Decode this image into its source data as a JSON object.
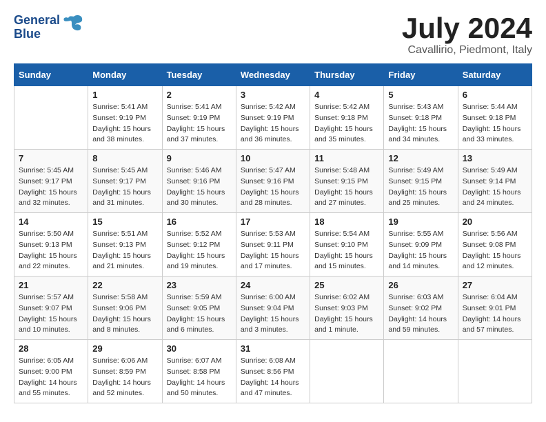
{
  "header": {
    "logo_line1": "General",
    "logo_line2": "Blue",
    "month_year": "July 2024",
    "location": "Cavallirio, Piedmont, Italy"
  },
  "days_of_week": [
    "Sunday",
    "Monday",
    "Tuesday",
    "Wednesday",
    "Thursday",
    "Friday",
    "Saturday"
  ],
  "weeks": [
    [
      {
        "day": "",
        "info": ""
      },
      {
        "day": "1",
        "info": "Sunrise: 5:41 AM\nSunset: 9:19 PM\nDaylight: 15 hours\nand 38 minutes."
      },
      {
        "day": "2",
        "info": "Sunrise: 5:41 AM\nSunset: 9:19 PM\nDaylight: 15 hours\nand 37 minutes."
      },
      {
        "day": "3",
        "info": "Sunrise: 5:42 AM\nSunset: 9:19 PM\nDaylight: 15 hours\nand 36 minutes."
      },
      {
        "day": "4",
        "info": "Sunrise: 5:42 AM\nSunset: 9:18 PM\nDaylight: 15 hours\nand 35 minutes."
      },
      {
        "day": "5",
        "info": "Sunrise: 5:43 AM\nSunset: 9:18 PM\nDaylight: 15 hours\nand 34 minutes."
      },
      {
        "day": "6",
        "info": "Sunrise: 5:44 AM\nSunset: 9:18 PM\nDaylight: 15 hours\nand 33 minutes."
      }
    ],
    [
      {
        "day": "7",
        "info": "Sunrise: 5:45 AM\nSunset: 9:17 PM\nDaylight: 15 hours\nand 32 minutes."
      },
      {
        "day": "8",
        "info": "Sunrise: 5:45 AM\nSunset: 9:17 PM\nDaylight: 15 hours\nand 31 minutes."
      },
      {
        "day": "9",
        "info": "Sunrise: 5:46 AM\nSunset: 9:16 PM\nDaylight: 15 hours\nand 30 minutes."
      },
      {
        "day": "10",
        "info": "Sunrise: 5:47 AM\nSunset: 9:16 PM\nDaylight: 15 hours\nand 28 minutes."
      },
      {
        "day": "11",
        "info": "Sunrise: 5:48 AM\nSunset: 9:15 PM\nDaylight: 15 hours\nand 27 minutes."
      },
      {
        "day": "12",
        "info": "Sunrise: 5:49 AM\nSunset: 9:15 PM\nDaylight: 15 hours\nand 25 minutes."
      },
      {
        "day": "13",
        "info": "Sunrise: 5:49 AM\nSunset: 9:14 PM\nDaylight: 15 hours\nand 24 minutes."
      }
    ],
    [
      {
        "day": "14",
        "info": "Sunrise: 5:50 AM\nSunset: 9:13 PM\nDaylight: 15 hours\nand 22 minutes."
      },
      {
        "day": "15",
        "info": "Sunrise: 5:51 AM\nSunset: 9:13 PM\nDaylight: 15 hours\nand 21 minutes."
      },
      {
        "day": "16",
        "info": "Sunrise: 5:52 AM\nSunset: 9:12 PM\nDaylight: 15 hours\nand 19 minutes."
      },
      {
        "day": "17",
        "info": "Sunrise: 5:53 AM\nSunset: 9:11 PM\nDaylight: 15 hours\nand 17 minutes."
      },
      {
        "day": "18",
        "info": "Sunrise: 5:54 AM\nSunset: 9:10 PM\nDaylight: 15 hours\nand 15 minutes."
      },
      {
        "day": "19",
        "info": "Sunrise: 5:55 AM\nSunset: 9:09 PM\nDaylight: 15 hours\nand 14 minutes."
      },
      {
        "day": "20",
        "info": "Sunrise: 5:56 AM\nSunset: 9:08 PM\nDaylight: 15 hours\nand 12 minutes."
      }
    ],
    [
      {
        "day": "21",
        "info": "Sunrise: 5:57 AM\nSunset: 9:07 PM\nDaylight: 15 hours\nand 10 minutes."
      },
      {
        "day": "22",
        "info": "Sunrise: 5:58 AM\nSunset: 9:06 PM\nDaylight: 15 hours\nand 8 minutes."
      },
      {
        "day": "23",
        "info": "Sunrise: 5:59 AM\nSunset: 9:05 PM\nDaylight: 15 hours\nand 6 minutes."
      },
      {
        "day": "24",
        "info": "Sunrise: 6:00 AM\nSunset: 9:04 PM\nDaylight: 15 hours\nand 3 minutes."
      },
      {
        "day": "25",
        "info": "Sunrise: 6:02 AM\nSunset: 9:03 PM\nDaylight: 15 hours\nand 1 minute."
      },
      {
        "day": "26",
        "info": "Sunrise: 6:03 AM\nSunset: 9:02 PM\nDaylight: 14 hours\nand 59 minutes."
      },
      {
        "day": "27",
        "info": "Sunrise: 6:04 AM\nSunset: 9:01 PM\nDaylight: 14 hours\nand 57 minutes."
      }
    ],
    [
      {
        "day": "28",
        "info": "Sunrise: 6:05 AM\nSunset: 9:00 PM\nDaylight: 14 hours\nand 55 minutes."
      },
      {
        "day": "29",
        "info": "Sunrise: 6:06 AM\nSunset: 8:59 PM\nDaylight: 14 hours\nand 52 minutes."
      },
      {
        "day": "30",
        "info": "Sunrise: 6:07 AM\nSunset: 8:58 PM\nDaylight: 14 hours\nand 50 minutes."
      },
      {
        "day": "31",
        "info": "Sunrise: 6:08 AM\nSunset: 8:56 PM\nDaylight: 14 hours\nand 47 minutes."
      },
      {
        "day": "",
        "info": ""
      },
      {
        "day": "",
        "info": ""
      },
      {
        "day": "",
        "info": ""
      }
    ]
  ]
}
